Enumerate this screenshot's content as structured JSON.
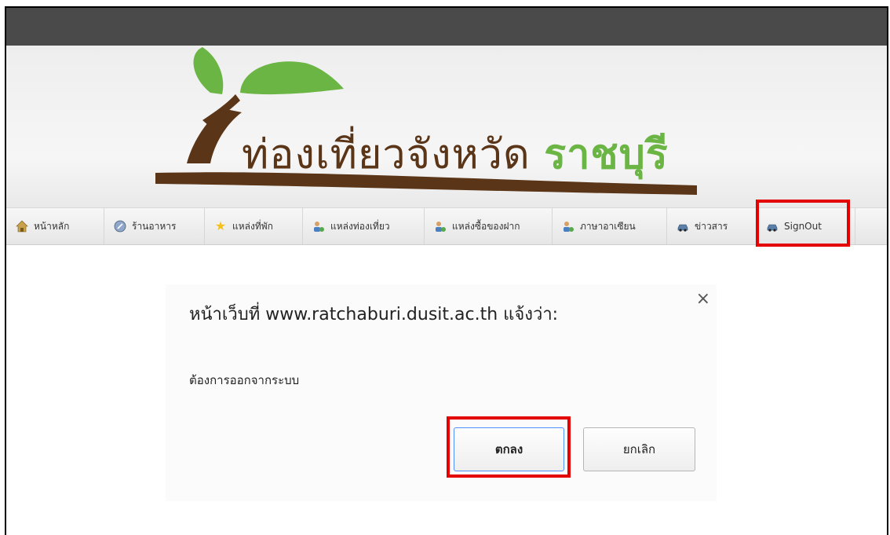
{
  "banner": {
    "title_main": "ท่องเที่ยวจังหวัด",
    "title_accent": "ราชบุรี"
  },
  "nav": {
    "items": [
      {
        "label": "หน้าหลัก",
        "icon": "home-icon"
      },
      {
        "label": "ร้านอาหาร",
        "icon": "restaurant-icon"
      },
      {
        "label": "แหล่งที่พัก",
        "icon": "star-icon"
      },
      {
        "label": "แหล่งท่องเที่ยว",
        "icon": "users-icon"
      },
      {
        "label": "แหล่งซื้อของฝาก",
        "icon": "users-icon"
      },
      {
        "label": "ภาษาอาเซียน",
        "icon": "users-icon"
      },
      {
        "label": "ข่าวสาร",
        "icon": "car-icon"
      },
      {
        "label": "SignOut",
        "icon": "car-icon"
      }
    ]
  },
  "dialog": {
    "title": "หน้าเว็บที่ www.ratchaburi.dusit.ac.th แจ้งว่า:",
    "close": "×",
    "message": "ต้องการออกจากระบบ",
    "ok_label": "ตกลง",
    "cancel_label": "ยกเลิก"
  },
  "colors": {
    "highlight": "#e50000",
    "logo_brown": "#5a3517",
    "logo_green": "#6bb544",
    "topbar": "#4a4a4a"
  }
}
